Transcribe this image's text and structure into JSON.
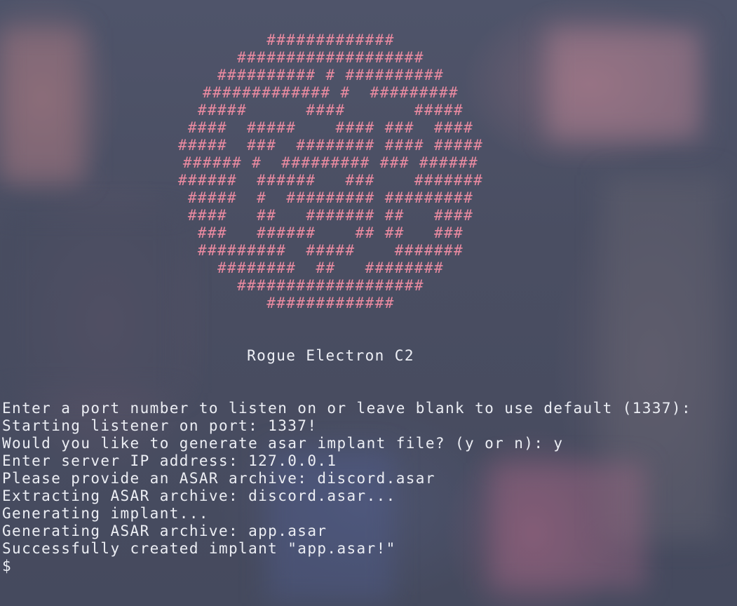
{
  "terminal": {
    "logo_lines": [
      "#############",
      "###################",
      "########## # ##########",
      "############# #  #########",
      "#####      ####       #####",
      "####  #####    #### ###  ####",
      "#####  ###  ######## #### #####",
      "###### #  ######### ### ######",
      "######  ######   ###    #######",
      "#####  #  ######### #########",
      "####   ##   ####### ##   ####",
      "###   ######    ## ##   ###",
      "#########  #####    #######",
      "########  ##   ########",
      "###################",
      "#############"
    ],
    "app_title": "Rogue Electron C2",
    "output_lines": [
      "Enter a port number to listen on or leave blank to use default (1337):",
      "Starting listener on port: 1337!",
      "Would you like to generate asar implant file? (y or n): y",
      "Enter server IP address: 127.0.0.1",
      "Please provide an ASAR archive: discord.asar",
      "Extracting ASAR archive: discord.asar...",
      "Generating implant...",
      "Generating ASAR archive: app.asar",
      "Successfully created implant \"app.asar!\""
    ],
    "prompt": "$"
  },
  "colors": {
    "logo": "#e98aa0",
    "text": "#eceef4",
    "background": "#4a4f63"
  }
}
